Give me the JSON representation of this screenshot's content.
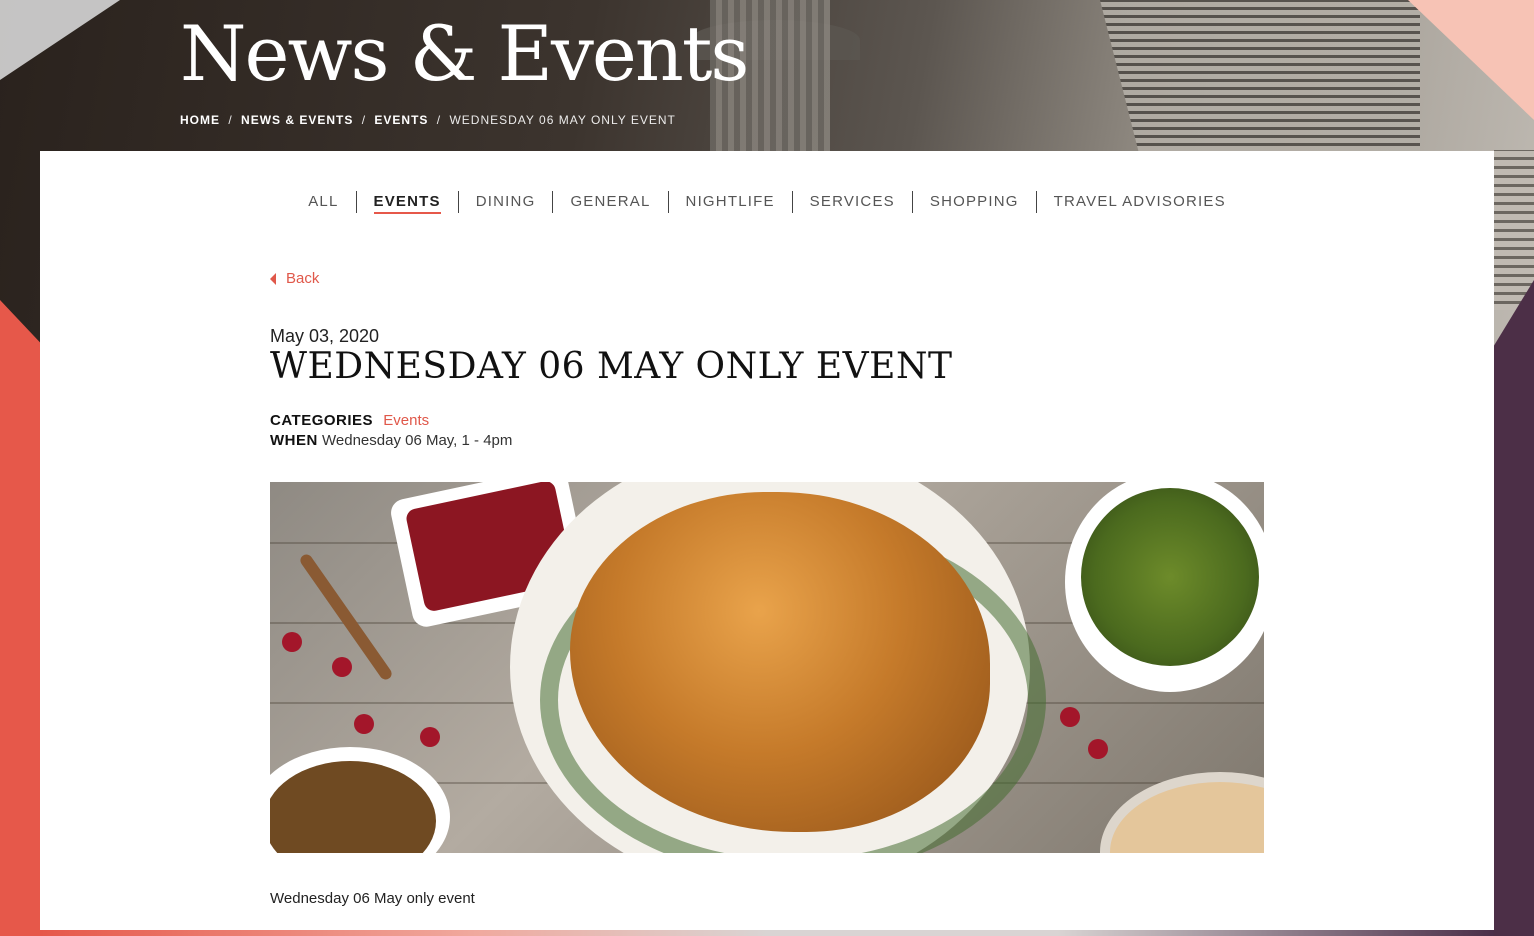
{
  "header": {
    "title": "News & Events",
    "breadcrumb": [
      {
        "label": "HOME"
      },
      {
        "label": "NEWS & EVENTS"
      },
      {
        "label": "EVENTS"
      }
    ],
    "breadcrumb_current": "WEDNESDAY 06 MAY ONLY EVENT",
    "separator": "/"
  },
  "tabs": [
    {
      "label": "ALL",
      "active": false
    },
    {
      "label": "EVENTS",
      "active": true
    },
    {
      "label": "DINING",
      "active": false
    },
    {
      "label": "GENERAL",
      "active": false
    },
    {
      "label": "NIGHTLIFE",
      "active": false
    },
    {
      "label": "SERVICES",
      "active": false
    },
    {
      "label": "SHOPPING",
      "active": false
    },
    {
      "label": "TRAVEL ADVISORIES",
      "active": false
    }
  ],
  "back_label": "Back",
  "article": {
    "date": "May 03, 2020",
    "title": "WEDNESDAY 06 MAY ONLY EVENT",
    "categories_label": "CATEGORIES",
    "category": "Events",
    "when_label": "WHEN",
    "when": "Wednesday 06 May, 1 - 4pm",
    "body": "Wednesday 06 May only event"
  },
  "colors": {
    "accent": "#e0584a",
    "plum": "#4b2f49",
    "pink": "#f7c3b5"
  }
}
